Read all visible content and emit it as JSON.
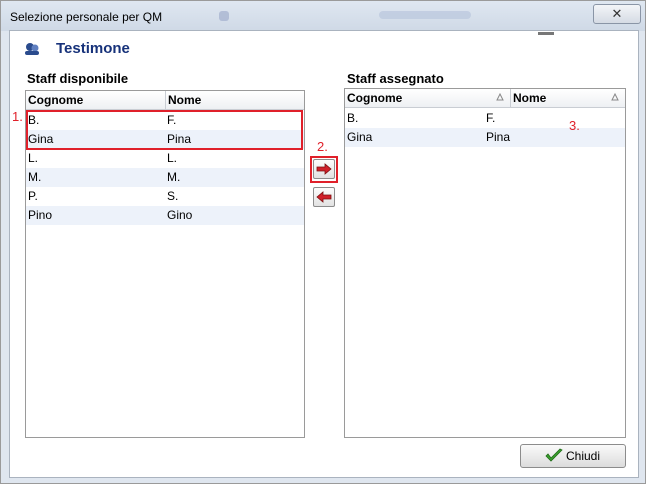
{
  "window": {
    "title": "Selezione personale per QM",
    "close_symbol": "✕"
  },
  "header": {
    "title": "Testimone"
  },
  "left": {
    "label": "Staff disponibile",
    "columns": [
      "Cognome",
      "Nome"
    ],
    "rows": [
      {
        "cognome": "B.",
        "nome": "F."
      },
      {
        "cognome": "Gina",
        "nome": "Pina"
      },
      {
        "cognome": "L.",
        "nome": "L."
      },
      {
        "cognome": "M.",
        "nome": "M."
      },
      {
        "cognome": "P.",
        "nome": "S."
      },
      {
        "cognome": "Pino",
        "nome": "Gino"
      }
    ]
  },
  "right": {
    "label": "Staff assegnato",
    "columns": [
      "Cognome",
      "Nome"
    ],
    "rows": [
      {
        "cognome": "B.",
        "nome": "F."
      },
      {
        "cognome": "Gina",
        "nome": "Pina"
      }
    ]
  },
  "annotations": {
    "one": "1.",
    "two": "2.",
    "three": "3."
  },
  "buttons": {
    "close": "Chiudi"
  },
  "colors": {
    "annotation": "#e0202a",
    "title": "#17327a",
    "alt_row": "#edf2fa"
  }
}
